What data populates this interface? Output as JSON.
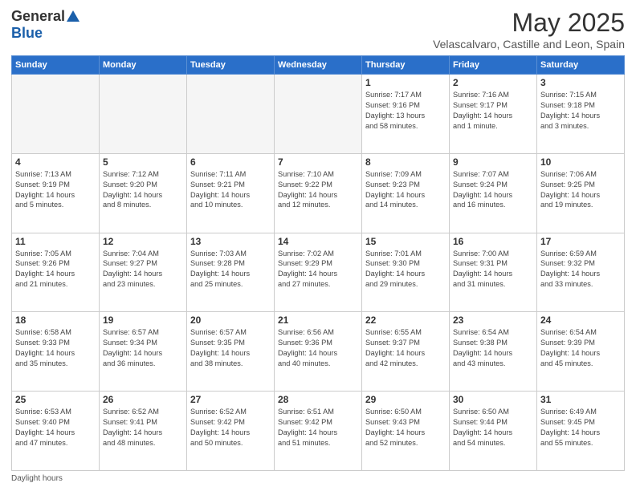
{
  "header": {
    "logo_general": "General",
    "logo_blue": "Blue",
    "month_title": "May 2025",
    "location": "Velascalvaro, Castille and Leon, Spain"
  },
  "days_of_week": [
    "Sunday",
    "Monday",
    "Tuesday",
    "Wednesday",
    "Thursday",
    "Friday",
    "Saturday"
  ],
  "footer": {
    "daylight_label": "Daylight hours"
  },
  "weeks": [
    [
      {
        "day": "",
        "info": ""
      },
      {
        "day": "",
        "info": ""
      },
      {
        "day": "",
        "info": ""
      },
      {
        "day": "",
        "info": ""
      },
      {
        "day": "1",
        "info": "Sunrise: 7:17 AM\nSunset: 9:16 PM\nDaylight: 13 hours\nand 58 minutes."
      },
      {
        "day": "2",
        "info": "Sunrise: 7:16 AM\nSunset: 9:17 PM\nDaylight: 14 hours\nand 1 minute."
      },
      {
        "day": "3",
        "info": "Sunrise: 7:15 AM\nSunset: 9:18 PM\nDaylight: 14 hours\nand 3 minutes."
      }
    ],
    [
      {
        "day": "4",
        "info": "Sunrise: 7:13 AM\nSunset: 9:19 PM\nDaylight: 14 hours\nand 5 minutes."
      },
      {
        "day": "5",
        "info": "Sunrise: 7:12 AM\nSunset: 9:20 PM\nDaylight: 14 hours\nand 8 minutes."
      },
      {
        "day": "6",
        "info": "Sunrise: 7:11 AM\nSunset: 9:21 PM\nDaylight: 14 hours\nand 10 minutes."
      },
      {
        "day": "7",
        "info": "Sunrise: 7:10 AM\nSunset: 9:22 PM\nDaylight: 14 hours\nand 12 minutes."
      },
      {
        "day": "8",
        "info": "Sunrise: 7:09 AM\nSunset: 9:23 PM\nDaylight: 14 hours\nand 14 minutes."
      },
      {
        "day": "9",
        "info": "Sunrise: 7:07 AM\nSunset: 9:24 PM\nDaylight: 14 hours\nand 16 minutes."
      },
      {
        "day": "10",
        "info": "Sunrise: 7:06 AM\nSunset: 9:25 PM\nDaylight: 14 hours\nand 19 minutes."
      }
    ],
    [
      {
        "day": "11",
        "info": "Sunrise: 7:05 AM\nSunset: 9:26 PM\nDaylight: 14 hours\nand 21 minutes."
      },
      {
        "day": "12",
        "info": "Sunrise: 7:04 AM\nSunset: 9:27 PM\nDaylight: 14 hours\nand 23 minutes."
      },
      {
        "day": "13",
        "info": "Sunrise: 7:03 AM\nSunset: 9:28 PM\nDaylight: 14 hours\nand 25 minutes."
      },
      {
        "day": "14",
        "info": "Sunrise: 7:02 AM\nSunset: 9:29 PM\nDaylight: 14 hours\nand 27 minutes."
      },
      {
        "day": "15",
        "info": "Sunrise: 7:01 AM\nSunset: 9:30 PM\nDaylight: 14 hours\nand 29 minutes."
      },
      {
        "day": "16",
        "info": "Sunrise: 7:00 AM\nSunset: 9:31 PM\nDaylight: 14 hours\nand 31 minutes."
      },
      {
        "day": "17",
        "info": "Sunrise: 6:59 AM\nSunset: 9:32 PM\nDaylight: 14 hours\nand 33 minutes."
      }
    ],
    [
      {
        "day": "18",
        "info": "Sunrise: 6:58 AM\nSunset: 9:33 PM\nDaylight: 14 hours\nand 35 minutes."
      },
      {
        "day": "19",
        "info": "Sunrise: 6:57 AM\nSunset: 9:34 PM\nDaylight: 14 hours\nand 36 minutes."
      },
      {
        "day": "20",
        "info": "Sunrise: 6:57 AM\nSunset: 9:35 PM\nDaylight: 14 hours\nand 38 minutes."
      },
      {
        "day": "21",
        "info": "Sunrise: 6:56 AM\nSunset: 9:36 PM\nDaylight: 14 hours\nand 40 minutes."
      },
      {
        "day": "22",
        "info": "Sunrise: 6:55 AM\nSunset: 9:37 PM\nDaylight: 14 hours\nand 42 minutes."
      },
      {
        "day": "23",
        "info": "Sunrise: 6:54 AM\nSunset: 9:38 PM\nDaylight: 14 hours\nand 43 minutes."
      },
      {
        "day": "24",
        "info": "Sunrise: 6:54 AM\nSunset: 9:39 PM\nDaylight: 14 hours\nand 45 minutes."
      }
    ],
    [
      {
        "day": "25",
        "info": "Sunrise: 6:53 AM\nSunset: 9:40 PM\nDaylight: 14 hours\nand 47 minutes."
      },
      {
        "day": "26",
        "info": "Sunrise: 6:52 AM\nSunset: 9:41 PM\nDaylight: 14 hours\nand 48 minutes."
      },
      {
        "day": "27",
        "info": "Sunrise: 6:52 AM\nSunset: 9:42 PM\nDaylight: 14 hours\nand 50 minutes."
      },
      {
        "day": "28",
        "info": "Sunrise: 6:51 AM\nSunset: 9:42 PM\nDaylight: 14 hours\nand 51 minutes."
      },
      {
        "day": "29",
        "info": "Sunrise: 6:50 AM\nSunset: 9:43 PM\nDaylight: 14 hours\nand 52 minutes."
      },
      {
        "day": "30",
        "info": "Sunrise: 6:50 AM\nSunset: 9:44 PM\nDaylight: 14 hours\nand 54 minutes."
      },
      {
        "day": "31",
        "info": "Sunrise: 6:49 AM\nSunset: 9:45 PM\nDaylight: 14 hours\nand 55 minutes."
      }
    ]
  ]
}
